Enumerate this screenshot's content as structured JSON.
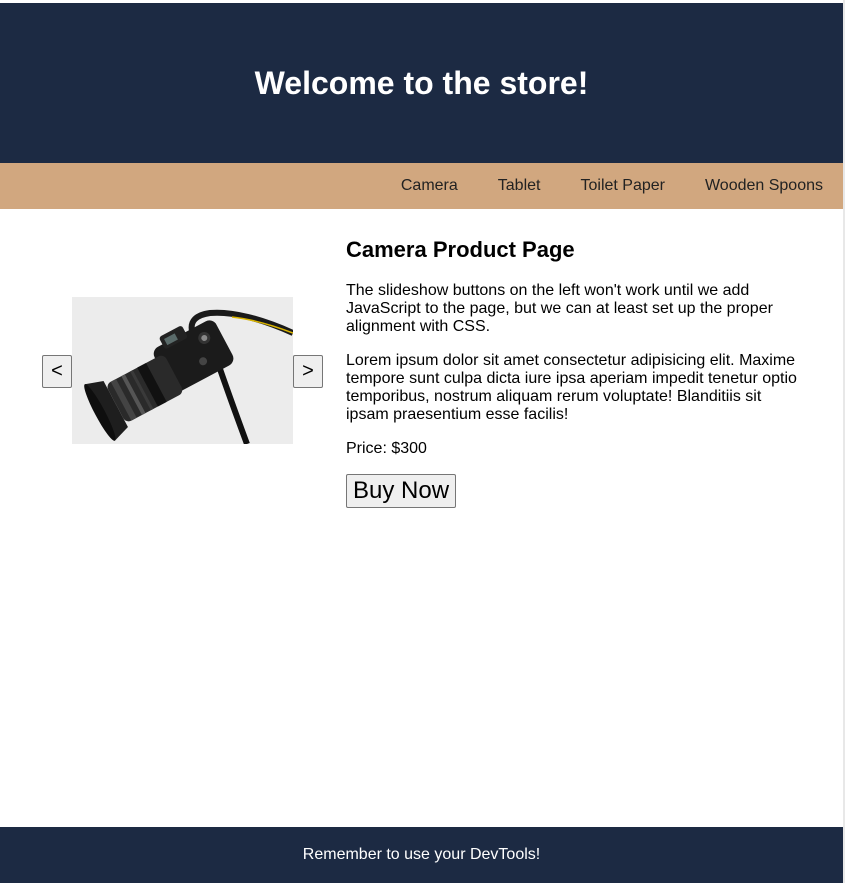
{
  "header": {
    "title": "Welcome to the store!"
  },
  "nav": {
    "items": [
      {
        "label": "Camera"
      },
      {
        "label": "Tablet"
      },
      {
        "label": "Toilet Paper"
      },
      {
        "label": "Wooden Spoons"
      }
    ]
  },
  "slideshow": {
    "prev_label": "<",
    "next_label": ">",
    "image_icon": "camera-photo"
  },
  "product": {
    "title": "Camera Product Page",
    "description_1": "The slideshow buttons on the left won't work until we add JavaScript to the page, but we can at least set up the proper alignment with CSS.",
    "description_2": "Lorem ipsum dolor sit amet consectetur adipisicing elit. Maxime tempore sunt culpa dicta iure ipsa aperiam impedit tenetur optio temporibus, nostrum aliquam rerum voluptate! Blanditiis sit ipsam praesentium esse facilis!",
    "price": "Price: $300",
    "buy_label": "Buy Now"
  },
  "footer": {
    "text": "Remember to use your DevTools!"
  },
  "colors": {
    "header_bg": "#1c2a43",
    "nav_bg": "#d1a77f",
    "footer_bg": "#1c2a43"
  }
}
